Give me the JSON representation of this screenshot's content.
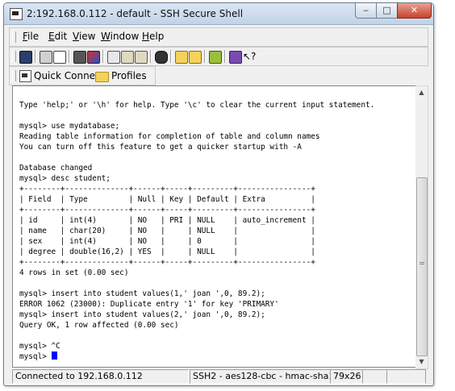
{
  "window": {
    "title": "2:192.168.0.112 - default - SSH Secure Shell",
    "controls": {
      "minimize": "‒",
      "maximize": "□",
      "close": "✕"
    }
  },
  "menu": {
    "items": [
      {
        "label": "File",
        "u": "F",
        "rest": "ile"
      },
      {
        "label": "Edit",
        "u": "E",
        "rest": "dit"
      },
      {
        "label": "View",
        "u": "V",
        "rest": "iew"
      },
      {
        "label": "Window",
        "u": "W",
        "rest": "indow"
      },
      {
        "label": "Help",
        "u": "H",
        "rest": "elp"
      }
    ]
  },
  "toolbar": {
    "icons": [
      "save-icon",
      "print-icon",
      "print-preview-icon",
      "disconnect-icon",
      "color-icon",
      "copy-icon",
      "paste-icon",
      "find-icon",
      "search-icon",
      "sftp-icon",
      "upload-icon",
      "settings-icon",
      "help-icon",
      "whats-this-icon"
    ],
    "colors": {
      "accent": "#0000ff",
      "folder": "#f4d25a"
    }
  },
  "quickbar": {
    "quick_connect": "Quick Connect",
    "profiles": "Profiles"
  },
  "terminal": {
    "lines": [
      "",
      "Type 'help;' or '\\h' for help. Type '\\c' to clear the current input statement.",
      "",
      "mysql> use mydatabase;",
      "Reading table information for completion of table and column names",
      "You can turn off this feature to get a quicker startup with -A",
      "",
      "Database changed",
      "mysql> desc student;",
      "+--------+--------------+------+-----+---------+----------------+",
      "| Field  | Type         | Null | Key | Default | Extra          |",
      "+--------+--------------+------+-----+---------+----------------+",
      "| id     | int(4)       | NO   | PRI | NULL    | auto_increment |",
      "| name   | char(20)     | NO   |     | NULL    |                |",
      "| sex    | int(4)       | NO   |     | 0       |                |",
      "| degree | double(16,2) | YES  |     | NULL    |                |",
      "+--------+--------------+------+-----+---------+----------------+",
      "4 rows in set (0.00 sec)",
      "",
      "mysql> insert into student values(1,' joan ',0, 89.2);",
      "ERROR 1062 (23000): Duplicate entry '1' for key 'PRIMARY'",
      "mysql> insert into student values(2,' joan ',0, 89.2);",
      "Query OK, 1 row affected (0.00 sec)",
      "",
      "mysql> ^C",
      "mysql> "
    ]
  },
  "status": {
    "connection": "Connected to 192.168.0.112",
    "cipher": "SSH2 - aes128-cbc - hmac-sha1",
    "size": "79x26"
  }
}
